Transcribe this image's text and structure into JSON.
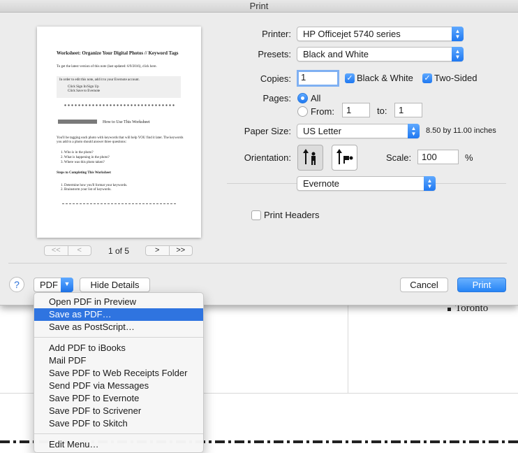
{
  "window": {
    "title": "Print"
  },
  "background": {
    "bullet_text": "Toronto"
  },
  "preview": {
    "doc_title": "Worksheet: Organize Your Digital Photos // Keyword Tags",
    "doc_line1": "To get the latest version of this note (last updated: 6/9/2016), click here.",
    "box_line1": "In order to edit this note, add it to your Evernote account.",
    "box_item1": "Click Sign In/Sign Up",
    "box_item2": "Click Save to Evernote",
    "howto": "How to Use This Worksheet",
    "para": "You'll be tagging each photo with keywords that will help YOU find it later. The keywords you add to a photo should answer three questions:",
    "q1": "1. Who is in the photo?",
    "q2": "2. What is happening in the photo?",
    "q3": "3. Where was this photo taken?",
    "steps_title": "Steps to Completing This Worksheet",
    "s1": "1. Determine how you'll format your keywords.",
    "s2": "2. Brainstorm your list of keywords.",
    "page_count": "1 of 5",
    "nav_first": "<<",
    "nav_prev": "<",
    "nav_next": ">",
    "nav_last": ">>"
  },
  "form": {
    "printer_label": "Printer:",
    "printer_value": "HP Officejet 5740 series",
    "presets_label": "Presets:",
    "presets_value": "Black and White",
    "copies_label": "Copies:",
    "copies_value": "1",
    "bw_label": "Black & White",
    "bw_checked": true,
    "twosided_label": "Two-Sided",
    "twosided_checked": true,
    "pages_label": "Pages:",
    "pages_all": "All",
    "pages_from": "From:",
    "from_value": "1",
    "to_label": "to:",
    "to_value": "1",
    "paper_label": "Paper Size:",
    "paper_value": "US Letter",
    "paper_dims": "8.50 by 11.00 inches",
    "orientation_label": "Orientation:",
    "scale_label": "Scale:",
    "scale_value": "100",
    "scale_unit": "%",
    "section_value": "Evernote",
    "print_headers_label": "Print Headers",
    "print_headers_checked": false
  },
  "buttons": {
    "help": "?",
    "pdf": "PDF",
    "hide_details": "Hide Details",
    "cancel": "Cancel",
    "print": "Print"
  },
  "pdf_menu": {
    "items_a": [
      "Open PDF in Preview",
      "Save as PDF…",
      "Save as PostScript…"
    ],
    "items_b": [
      "Add PDF to iBooks",
      "Mail PDF",
      "Save PDF to Web Receipts Folder",
      "Send PDF via Messages",
      "Save PDF to Evernote",
      "Save PDF to Scrivener",
      "Save PDF to Skitch"
    ],
    "items_c": [
      "Edit Menu…"
    ],
    "highlighted": "Save as PDF…"
  },
  "colors": {
    "accent": "#2f74e0",
    "sheet_bg": "#ececec"
  }
}
